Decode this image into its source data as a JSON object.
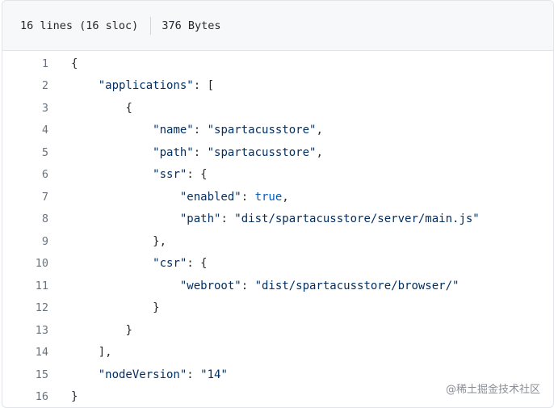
{
  "file_info": {
    "lines": "16 lines (16 sloc)",
    "size": "376 Bytes"
  },
  "code_lines": [
    {
      "n": "1",
      "indent": 0,
      "parts": [
        [
          "p",
          "{"
        ]
      ]
    },
    {
      "n": "2",
      "indent": 1,
      "parts": [
        [
          "k",
          "\"applications\""
        ],
        [
          "p",
          ": ["
        ]
      ]
    },
    {
      "n": "3",
      "indent": 2,
      "parts": [
        [
          "p",
          "{"
        ]
      ]
    },
    {
      "n": "4",
      "indent": 3,
      "parts": [
        [
          "k",
          "\"name\""
        ],
        [
          "p",
          ": "
        ],
        [
          "s",
          "\"spartacusstore\""
        ],
        [
          "p",
          ","
        ]
      ]
    },
    {
      "n": "5",
      "indent": 3,
      "parts": [
        [
          "k",
          "\"path\""
        ],
        [
          "p",
          ": "
        ],
        [
          "s",
          "\"spartacusstore\""
        ],
        [
          "p",
          ","
        ]
      ]
    },
    {
      "n": "6",
      "indent": 3,
      "parts": [
        [
          "k",
          "\"ssr\""
        ],
        [
          "p",
          ": {"
        ]
      ]
    },
    {
      "n": "7",
      "indent": 4,
      "parts": [
        [
          "k",
          "\"enabled\""
        ],
        [
          "p",
          ": "
        ],
        [
          "b",
          "true"
        ],
        [
          "p",
          ","
        ]
      ]
    },
    {
      "n": "8",
      "indent": 4,
      "parts": [
        [
          "k",
          "\"path\""
        ],
        [
          "p",
          ": "
        ],
        [
          "s",
          "\"dist/spartacusstore/server/main.js\""
        ]
      ]
    },
    {
      "n": "9",
      "indent": 3,
      "parts": [
        [
          "p",
          "},"
        ]
      ]
    },
    {
      "n": "10",
      "indent": 3,
      "parts": [
        [
          "k",
          "\"csr\""
        ],
        [
          "p",
          ": {"
        ]
      ]
    },
    {
      "n": "11",
      "indent": 4,
      "parts": [
        [
          "k",
          "\"webroot\""
        ],
        [
          "p",
          ": "
        ],
        [
          "s",
          "\"dist/spartacusstore/browser/\""
        ]
      ]
    },
    {
      "n": "12",
      "indent": 3,
      "parts": [
        [
          "p",
          "}"
        ]
      ]
    },
    {
      "n": "13",
      "indent": 2,
      "parts": [
        [
          "p",
          "}"
        ]
      ]
    },
    {
      "n": "14",
      "indent": 1,
      "parts": [
        [
          "p",
          "],"
        ]
      ]
    },
    {
      "n": "15",
      "indent": 1,
      "parts": [
        [
          "k",
          "\"nodeVersion\""
        ],
        [
          "p",
          ": "
        ],
        [
          "s",
          "\"14\""
        ]
      ]
    },
    {
      "n": "16",
      "indent": 0,
      "parts": [
        [
          "p",
          "}"
        ]
      ]
    }
  ],
  "watermark": "@稀土掘金技术社区"
}
